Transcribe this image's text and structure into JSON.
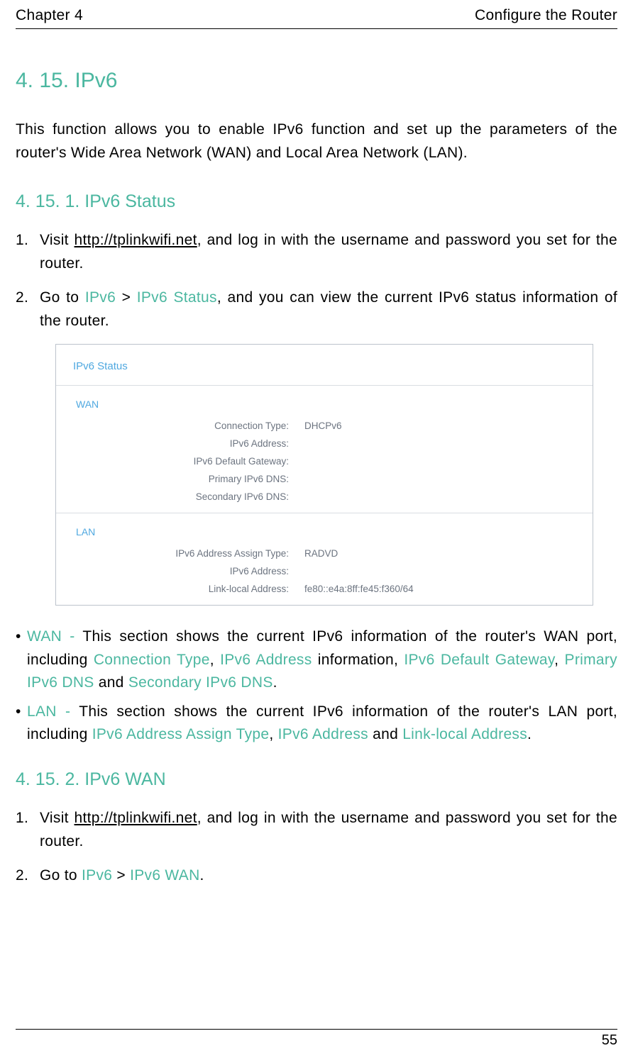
{
  "header": {
    "chapter": "Chapter 4",
    "title": "Configure the Router"
  },
  "h1": "4. 15.   IPv6",
  "intro": "This function allows you to enable IPv6 function and set up the parameters of the router's Wide Area Network (WAN) and Local Area Network (LAN).",
  "sec1": {
    "heading": "4. 15. 1.    IPv6 Status",
    "step1": {
      "num": "1.",
      "pre": "Visit ",
      "link": "http://tplinkwifi.net",
      "post": ", and log in with the username and password you set for the router."
    },
    "step2": {
      "num": "2.",
      "t1": "Go to ",
      "m1": "IPv6",
      "t2": " > ",
      "m2": "IPv6 Status",
      "t3": ", and you can view the current IPv6 status information of the router."
    }
  },
  "panel": {
    "title": "IPv6 Status",
    "wan": {
      "label": "WAN",
      "rows": [
        {
          "label": "Connection Type:",
          "value": "DHCPv6"
        },
        {
          "label": "IPv6 Address:",
          "value": ""
        },
        {
          "label": "IPv6 Default Gateway:",
          "value": ""
        },
        {
          "label": "Primary IPv6 DNS:",
          "value": ""
        },
        {
          "label": "Secondary IPv6 DNS:",
          "value": ""
        }
      ]
    },
    "lan": {
      "label": "LAN",
      "rows": [
        {
          "label": "IPv6 Address Assign Type:",
          "value": "RADVD"
        },
        {
          "label": "IPv6 Address:",
          "value": ""
        },
        {
          "label": "Link-local Address:",
          "value": "fe80::e4a:8ff:fe45:f360/64"
        }
      ]
    }
  },
  "bullets": {
    "wan": {
      "m0": "WAN - ",
      "t1": "This section shows the current IPv6 information of the router's WAN port, including ",
      "m1": "Connection Type",
      "t2": ", ",
      "m2": "IPv6 Address",
      "t3": " information, ",
      "m3": "IPv6 Default Gateway",
      "t4": ", ",
      "m4": "Primary IPv6 DNS",
      "t5": " and ",
      "m5": "Secondary IPv6 DNS",
      "t6": "."
    },
    "lan": {
      "m0": "LAN - ",
      "t1": "This section shows the current IPv6 information of the router's LAN port, including ",
      "m1": "IPv6 Address Assign Type",
      "t2": ", ",
      "m2": "IPv6 Address",
      "t3": " and ",
      "m3": "Link-local Address",
      "t4": "."
    }
  },
  "sec2": {
    "heading": "4. 15. 2.    IPv6 WAN",
    "step1": {
      "num": "1.",
      "pre": "Visit ",
      "link": "http://tplinkwifi.net",
      "post": ", and log in with the username and password you set for the router."
    },
    "step2": {
      "num": "2.",
      "t1": "Go to ",
      "m1": "IPv6",
      "t2": " > ",
      "m2": "IPv6 WAN",
      "t3": "."
    }
  },
  "footer": {
    "page": "55"
  }
}
